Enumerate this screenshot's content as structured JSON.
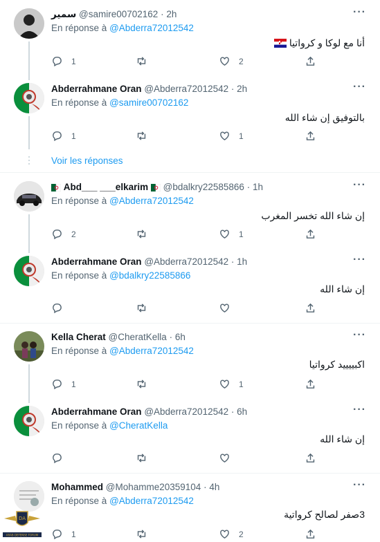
{
  "reply_prefix": "En réponse à",
  "voir_reponses": "Voir les réponses",
  "more_glyph": "···",
  "groups": [
    {
      "tweets": [
        {
          "name": "سمير",
          "handle": "@samire00702162",
          "time": "2h",
          "reply_to": "@Abderra72012542",
          "text": "أنا مع لوكا و كرواتيا",
          "counts": {
            "reply": "1",
            "retweet": "",
            "like": "2"
          }
        },
        {
          "name": "Abderrahmane Oran",
          "handle": "@Abderra72012542",
          "time": "2h",
          "reply_to": "@samire00702162",
          "text": "بالتوفيق إن شاء الله",
          "counts": {
            "reply": "1",
            "retweet": "",
            "like": "1"
          }
        }
      ]
    },
    {
      "tweets": [
        {
          "name": "Abd___ ___elkarim",
          "handle": "@bdalkry22585866",
          "time": "1h",
          "reply_to": "@Abderra72012542",
          "text": "إن شاء الله تخسر المغرب",
          "counts": {
            "reply": "2",
            "retweet": "",
            "like": "1"
          }
        },
        {
          "name": "Abderrahmane Oran",
          "handle": "@Abderra72012542",
          "time": "1h",
          "reply_to": "@bdalkry22585866",
          "text": "إن شاء الله",
          "counts": {
            "reply": "",
            "retweet": "",
            "like": ""
          }
        }
      ]
    },
    {
      "tweets": [
        {
          "name": "Kella Cherat",
          "handle": "@CheratKella",
          "time": "6h",
          "reply_to": "@Abderra72012542",
          "text": "اكبييييد كرواتيا",
          "counts": {
            "reply": "1",
            "retweet": "",
            "like": "1"
          }
        },
        {
          "name": "Abderrahmane Oran",
          "handle": "@Abderra72012542",
          "time": "6h",
          "reply_to": "@CheratKella",
          "text": "إن شاء الله",
          "counts": {
            "reply": "",
            "retweet": "",
            "like": ""
          }
        }
      ]
    },
    {
      "tweets": [
        {
          "name": "Mohammed",
          "handle": "@Mohamme20359104",
          "time": "4h",
          "reply_to": "@Abderra72012542",
          "text": "3صفر لصالح كرواتية",
          "counts": {
            "reply": "1",
            "retweet": "",
            "like": "2"
          }
        }
      ]
    }
  ],
  "watermark_text": "ARAB DEFENSE FORUM",
  "colors": {
    "accent": "#1d9bf0",
    "secondary_text": "#536471",
    "thread_line": "#cfd9de",
    "divider": "#eff3f4"
  }
}
